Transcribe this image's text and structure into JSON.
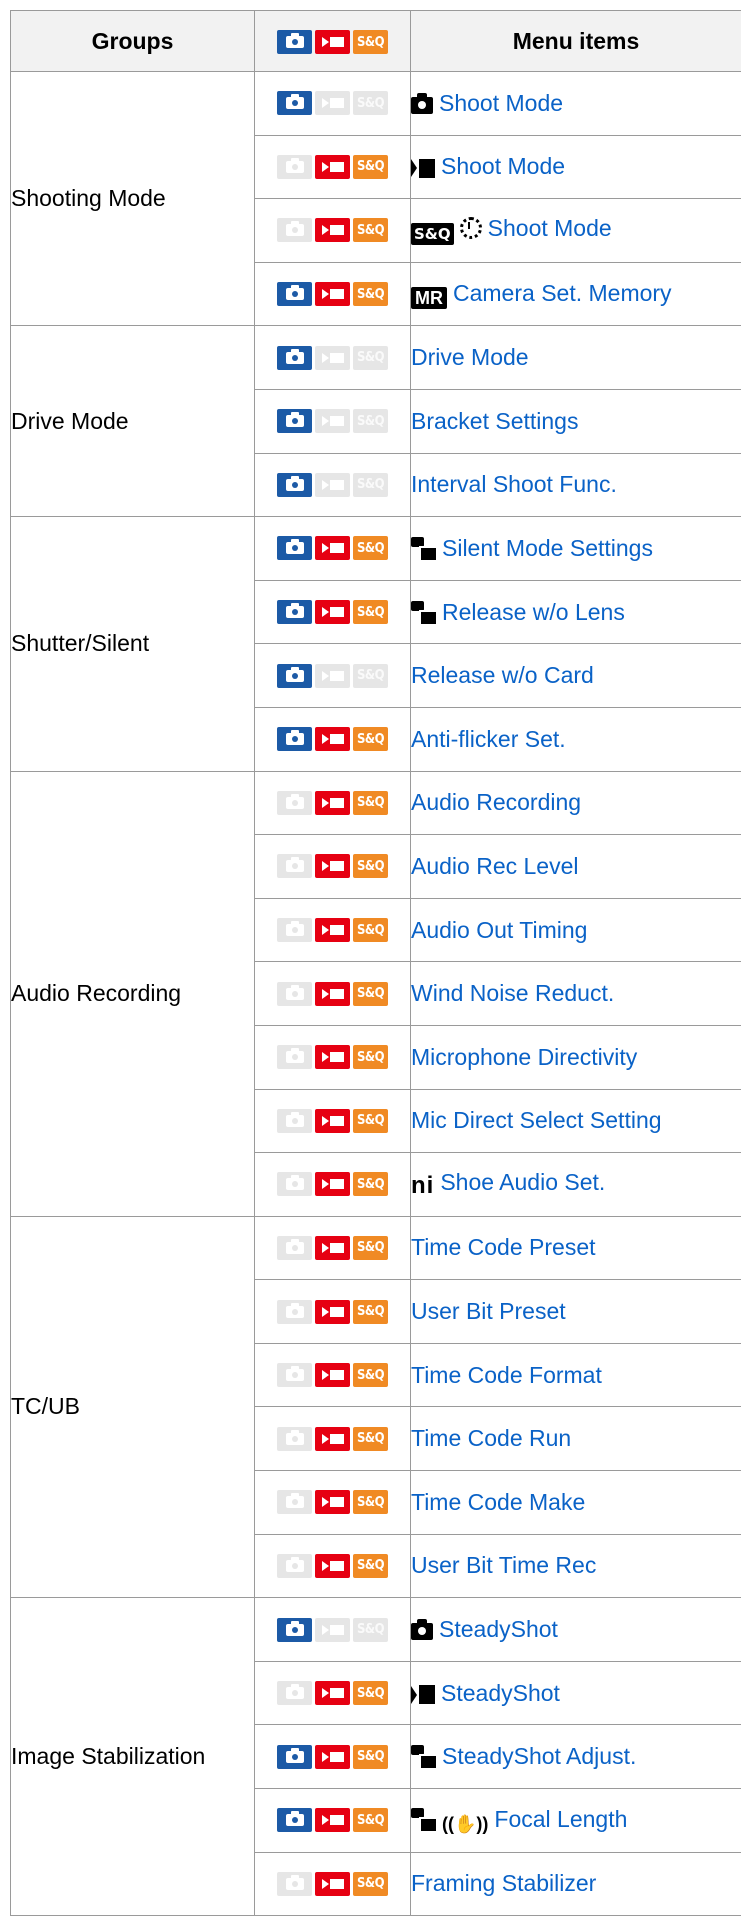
{
  "table": {
    "headers": [
      "Groups",
      "",
      "Menu items"
    ],
    "mode_labels": {
      "sq": "S&Q"
    },
    "groups": [
      {
        "name": "Shooting Mode",
        "rows": [
          {
            "modes": [
              1,
              0,
              0
            ],
            "icons": [
              "camera-icon"
            ],
            "label": "Shoot Mode"
          },
          {
            "modes": [
              0,
              1,
              1
            ],
            "icons": [
              "movie-icon"
            ],
            "label": "Shoot Mode"
          },
          {
            "modes": [
              0,
              1,
              1
            ],
            "icons": [
              "sq-icon",
              "dial-icon"
            ],
            "label": "Shoot Mode",
            "icon_text": "S&Q"
          },
          {
            "modes": [
              1,
              1,
              1
            ],
            "icons": [
              "mr-icon"
            ],
            "label": "Camera Set. Memory",
            "icon_text": "MR"
          }
        ]
      },
      {
        "name": "Drive Mode",
        "rows": [
          {
            "modes": [
              1,
              0,
              0
            ],
            "icons": [],
            "label": "Drive Mode"
          },
          {
            "modes": [
              1,
              0,
              0
            ],
            "icons": [],
            "label": "Bracket Settings"
          },
          {
            "modes": [
              1,
              0,
              0
            ],
            "icons": [],
            "label": "Interval Shoot Func."
          }
        ]
      },
      {
        "name": "Shutter/Silent",
        "rows": [
          {
            "modes": [
              1,
              1,
              1
            ],
            "icons": [
              "photo-movie-icon"
            ],
            "label": "Silent Mode Settings"
          },
          {
            "modes": [
              1,
              1,
              1
            ],
            "icons": [
              "photo-movie-icon"
            ],
            "label": "Release w/o Lens"
          },
          {
            "modes": [
              1,
              0,
              0
            ],
            "icons": [],
            "label": "Release w/o Card"
          },
          {
            "modes": [
              1,
              1,
              1
            ],
            "icons": [],
            "label": "Anti-flicker Set."
          }
        ]
      },
      {
        "name": "Audio Recording",
        "rows": [
          {
            "modes": [
              0,
              1,
              1
            ],
            "icons": [],
            "label": "Audio Recording"
          },
          {
            "modes": [
              0,
              1,
              1
            ],
            "icons": [],
            "label": "Audio Rec Level"
          },
          {
            "modes": [
              0,
              1,
              1
            ],
            "icons": [],
            "label": "Audio Out Timing"
          },
          {
            "modes": [
              0,
              1,
              1
            ],
            "icons": [],
            "label": "Wind Noise Reduct."
          },
          {
            "modes": [
              0,
              1,
              1
            ],
            "icons": [],
            "label": "Microphone Directivity"
          },
          {
            "modes": [
              0,
              1,
              1
            ],
            "icons": [],
            "label": "Mic Direct Select Setting"
          },
          {
            "modes": [
              0,
              1,
              1
            ],
            "icons": [
              "mi-shoe-icon"
            ],
            "label": "Shoe Audio Set."
          }
        ]
      },
      {
        "name": "TC/UB",
        "rows": [
          {
            "modes": [
              0,
              1,
              1
            ],
            "icons": [],
            "label": "Time Code Preset"
          },
          {
            "modes": [
              0,
              1,
              1
            ],
            "icons": [],
            "label": "User Bit Preset"
          },
          {
            "modes": [
              0,
              1,
              1
            ],
            "icons": [],
            "label": "Time Code Format"
          },
          {
            "modes": [
              0,
              1,
              1
            ],
            "icons": [],
            "label": "Time Code Run"
          },
          {
            "modes": [
              0,
              1,
              1
            ],
            "icons": [],
            "label": "Time Code Make"
          },
          {
            "modes": [
              0,
              1,
              1
            ],
            "icons": [],
            "label": "User Bit Time Rec"
          }
        ]
      },
      {
        "name": "Image Stabilization",
        "rows": [
          {
            "modes": [
              1,
              0,
              0
            ],
            "icons": [
              "camera-icon"
            ],
            "label": "SteadyShot"
          },
          {
            "modes": [
              0,
              1,
              1
            ],
            "icons": [
              "movie-icon"
            ],
            "label": "SteadyShot"
          },
          {
            "modes": [
              1,
              1,
              1
            ],
            "icons": [
              "photo-movie-icon"
            ],
            "label": "SteadyShot Adjust."
          },
          {
            "modes": [
              1,
              1,
              1
            ],
            "icons": [
              "photo-movie-icon",
              "steadyshot-hand-icon"
            ],
            "label": "Focal Length"
          },
          {
            "modes": [
              0,
              1,
              1
            ],
            "icons": [],
            "label": "Framing Stabilizer"
          }
        ]
      }
    ]
  }
}
